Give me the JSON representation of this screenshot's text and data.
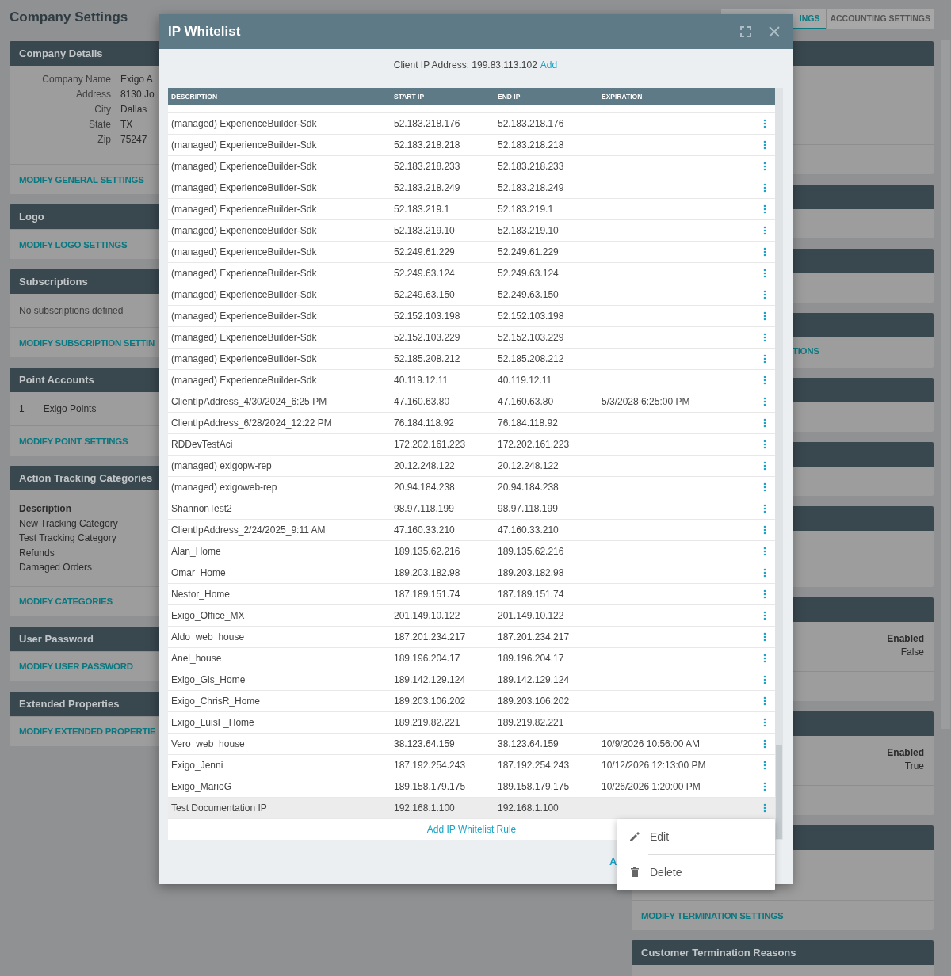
{
  "page_title": "Company Settings",
  "tabs": [
    {
      "label": "INGS",
      "selected": true
    },
    {
      "label": "ACCOUNTING SETTINGS",
      "selected": false
    }
  ],
  "left_cards": [
    {
      "title": "Company Details",
      "kind": "fields",
      "fields": [
        {
          "label": "Company Name",
          "value": "Exigo A"
        },
        {
          "label": "Address",
          "value": "8130 Jo"
        },
        {
          "label": "City",
          "value": "Dallas"
        },
        {
          "label": "State",
          "value": "TX"
        },
        {
          "label": "Zip",
          "value": "75247"
        }
      ],
      "link": "MODIFY GENERAL SETTINGS"
    },
    {
      "title": "Logo",
      "kind": "none",
      "link": "MODIFY LOGO SETTINGS"
    },
    {
      "title": "Subscriptions",
      "kind": "text",
      "text": "No subscriptions defined",
      "link": "MODIFY SUBSCRIPTION SETTIN"
    },
    {
      "title": "Point Accounts",
      "kind": "list",
      "items": [
        {
          "number": "1",
          "name": "Exigo Points"
        }
      ],
      "link": "MODIFY POINT SETTINGS"
    },
    {
      "title": "Action Tracking Categories",
      "kind": "table",
      "heading": "Description",
      "items": [
        "New Tracking Category",
        "Test Tracking Category",
        "Refunds",
        "Damaged Orders"
      ],
      "link": "MODIFY CATEGORIES"
    },
    {
      "title": "User Password",
      "kind": "none",
      "link": "MODIFY USER PASSWORD"
    },
    {
      "title": "Extended Properties",
      "kind": "none",
      "link": "MODIFY EXTENDED PROPERTIE"
    }
  ],
  "right_cards": [
    {
      "kind": "blank",
      "footer": true
    },
    {
      "kind": "blank",
      "footer": false
    },
    {
      "kind": "blank",
      "footer": false
    },
    {
      "kind": "link",
      "link": "TIONS",
      "footer": false
    },
    {
      "kind": "blank",
      "footer": false
    },
    {
      "kind": "blank",
      "footer": false
    },
    {
      "kind": "blank",
      "footer": false
    },
    {
      "kind": "setting",
      "heading": "Enabled",
      "value": "False",
      "footer": true
    },
    {
      "kind": "setting",
      "heading": "Enabled",
      "value": "True",
      "footer": true
    },
    {
      "kind": "blank",
      "footer": true,
      "link": "MODIFY TERMINATION SETTINGS"
    },
    {
      "kind": "blank",
      "title": "Customer Termination Reasons",
      "footer": false
    }
  ],
  "dialog": {
    "title": "IP Whitelist",
    "client_ip_label": "Client IP Address: 199.83.113.102",
    "client_ip_add": "Add",
    "columns": [
      "DESCRIPTION",
      "START IP",
      "END IP",
      "EXPIRATION"
    ],
    "rows": [
      {
        "description": "(managed) ExperienceBuilder-Sdk",
        "start_ip": "52.183.218.176",
        "end_ip": "52.183.218.176",
        "selected": false
      },
      {
        "description": "(managed) ExperienceBuilder-Sdk",
        "start_ip": "52.183.218.218",
        "end_ip": "52.183.218.218",
        "selected": false
      },
      {
        "description": "(managed) ExperienceBuilder-Sdk",
        "start_ip": "52.183.218.233",
        "end_ip": "52.183.218.233",
        "selected": false
      },
      {
        "description": "(managed) ExperienceBuilder-Sdk",
        "start_ip": "52.183.218.249",
        "end_ip": "52.183.218.249",
        "selected": false
      },
      {
        "description": "(managed) ExperienceBuilder-Sdk",
        "start_ip": "52.183.219.1",
        "end_ip": "52.183.219.1",
        "selected": false
      },
      {
        "description": "(managed) ExperienceBuilder-Sdk",
        "start_ip": "52.183.219.10",
        "end_ip": "52.183.219.10",
        "selected": false
      },
      {
        "description": "(managed) ExperienceBuilder-Sdk",
        "start_ip": "52.249.61.229",
        "end_ip": "52.249.61.229",
        "selected": false
      },
      {
        "description": "(managed) ExperienceBuilder-Sdk",
        "start_ip": "52.249.63.124",
        "end_ip": "52.249.63.124",
        "selected": false
      },
      {
        "description": "(managed) ExperienceBuilder-Sdk",
        "start_ip": "52.249.63.150",
        "end_ip": "52.249.63.150",
        "selected": false
      },
      {
        "description": "(managed) ExperienceBuilder-Sdk",
        "start_ip": "52.152.103.198",
        "end_ip": "52.152.103.198",
        "selected": false
      },
      {
        "description": "(managed) ExperienceBuilder-Sdk",
        "start_ip": "52.152.103.229",
        "end_ip": "52.152.103.229",
        "selected": false
      },
      {
        "description": "(managed) ExperienceBuilder-Sdk",
        "start_ip": "52.185.208.212",
        "end_ip": "52.185.208.212",
        "selected": false
      },
      {
        "description": "(managed) ExperienceBuilder-Sdk",
        "start_ip": "40.119.12.11",
        "end_ip": "40.119.12.11",
        "selected": false
      },
      {
        "description": "ClientIpAddress_4/30/2024_6:25 PM",
        "start_ip": "47.160.63.80",
        "end_ip": "47.160.63.80",
        "expiration": "5/3/2028 6:25:00 PM",
        "selected": false
      },
      {
        "description": "ClientIpAddress_6/28/2024_12:22 PM",
        "start_ip": "76.184.118.92",
        "end_ip": "76.184.118.92",
        "selected": false
      },
      {
        "description": "RDDevTestAci",
        "start_ip": "172.202.161.223",
        "end_ip": "172.202.161.223",
        "selected": false
      },
      {
        "description": "(managed) exigopw-rep",
        "start_ip": "20.12.248.122",
        "end_ip": "20.12.248.122",
        "selected": false
      },
      {
        "description": "(managed) exigoweb-rep",
        "start_ip": "20.94.184.238",
        "end_ip": "20.94.184.238",
        "selected": false
      },
      {
        "description": "ShannonTest2",
        "start_ip": "98.97.118.199",
        "end_ip": "98.97.118.199",
        "selected": false
      },
      {
        "description": "ClientIpAddress_2/24/2025_9:11 AM",
        "start_ip": "47.160.33.210",
        "end_ip": "47.160.33.210",
        "selected": false
      },
      {
        "description": "Alan_Home",
        "start_ip": "189.135.62.216",
        "end_ip": "189.135.62.216",
        "selected": false
      },
      {
        "description": "Omar_Home",
        "start_ip": "189.203.182.98",
        "end_ip": "189.203.182.98",
        "selected": false
      },
      {
        "description": "Nestor_Home",
        "start_ip": "187.189.151.74",
        "end_ip": "187.189.151.74",
        "selected": false
      },
      {
        "description": "Exigo_Office_MX",
        "start_ip": "201.149.10.122",
        "end_ip": "201.149.10.122",
        "selected": false
      },
      {
        "description": "Aldo_web_house",
        "start_ip": "187.201.234.217",
        "end_ip": "187.201.234.217",
        "selected": false
      },
      {
        "description": "Anel_house",
        "start_ip": "189.196.204.17",
        "end_ip": "189.196.204.17",
        "selected": false
      },
      {
        "description": "Exigo_Gis_Home",
        "start_ip": "189.142.129.124",
        "end_ip": "189.142.129.124",
        "selected": false
      },
      {
        "description": "Exigo_ChrisR_Home",
        "start_ip": "189.203.106.202",
        "end_ip": "189.203.106.202",
        "selected": false
      },
      {
        "description": "Exigo_LuisF_Home",
        "start_ip": "189.219.82.221",
        "end_ip": "189.219.82.221",
        "selected": false
      },
      {
        "description": "Vero_web_house",
        "start_ip": "38.123.64.159",
        "end_ip": "38.123.64.159",
        "expiration": "10/9/2026 10:56:00 AM",
        "selected": false
      },
      {
        "description": "Exigo_Jenni",
        "start_ip": "187.192.254.243",
        "end_ip": "187.192.254.243",
        "expiration": "10/12/2026 12:13:00 PM",
        "selected": false
      },
      {
        "description": "Exigo_MarioG",
        "start_ip": "189.158.179.175",
        "end_ip": "189.158.179.175",
        "expiration": "10/26/2026 1:20:00 PM",
        "selected": false
      },
      {
        "description": "Test Documentation IP",
        "start_ip": "192.168.1.100",
        "end_ip": "192.168.1.100",
        "selected": true
      }
    ],
    "add_rule": "Add IP Whitelist Rule",
    "footer_button": "A"
  },
  "context_menu": [
    {
      "kind": "edit",
      "label": "Edit"
    },
    {
      "kind": "delete",
      "label": "Delete"
    }
  ]
}
